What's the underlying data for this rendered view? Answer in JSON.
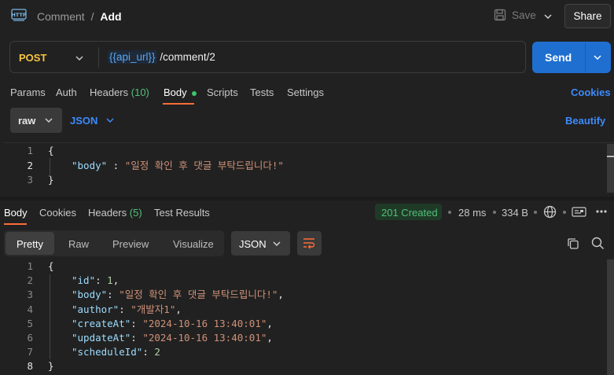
{
  "breadcrumb": {
    "parent": "Comment",
    "separator": "/",
    "current": "Add"
  },
  "header": {
    "save_label": "Save",
    "share_label": "Share"
  },
  "request": {
    "method": "POST",
    "url_variable": "{{api_url}}",
    "url_path": " /comment/2",
    "send_label": "Send"
  },
  "request_tabs": {
    "params": "Params",
    "auth": "Auth",
    "headers": "Headers",
    "headers_count": "(10)",
    "body": "Body",
    "scripts": "Scripts",
    "tests": "Tests",
    "settings": "Settings",
    "cookies": "Cookies"
  },
  "body_options": {
    "mode": "raw",
    "format": "JSON",
    "beautify": "Beautify"
  },
  "request_body": {
    "line_numbers": [
      "1",
      "2",
      "3"
    ],
    "open": "{",
    "key": "\"body\"",
    "colon": " : ",
    "value": "\"일정 확인 후 댓글 부탁드립니다!\"",
    "close": "}"
  },
  "response_tabs": {
    "body": "Body",
    "cookies": "Cookies",
    "headers": "Headers",
    "headers_count": "(5)",
    "test_results": "Test Results"
  },
  "response_status": {
    "status": "201 Created",
    "time": "28 ms",
    "size": "334 B",
    "status_color": "#52c07a"
  },
  "response_view": {
    "pretty": "Pretty",
    "raw": "Raw",
    "preview": "Preview",
    "visualize": "Visualize",
    "format": "JSON"
  },
  "response_body": {
    "line_numbers": [
      "1",
      "2",
      "3",
      "4",
      "5",
      "6",
      "7",
      "8"
    ],
    "open": "{",
    "k_id": "\"id\"",
    "v_id": "1",
    "k_body": "\"body\"",
    "v_body": "\"일정 확인 후 댓글 부탁드립니다!\"",
    "k_author": "\"author\"",
    "v_author": "\"개발자1\"",
    "k_createAt": "\"createAt\"",
    "v_createAt": "\"2024-10-16 13:40:01\"",
    "k_updateAt": "\"updateAt\"",
    "v_updateAt": "\"2024-10-16 13:40:01\"",
    "k_scheduleId": "\"scheduleId\"",
    "v_scheduleId": "2",
    "close": "}",
    "colon": ": ",
    "comma": ","
  },
  "colors": {
    "accent": "#ff6c37",
    "link": "#3d8bfd",
    "send": "#1f6fd1",
    "method": "#f5c542"
  }
}
